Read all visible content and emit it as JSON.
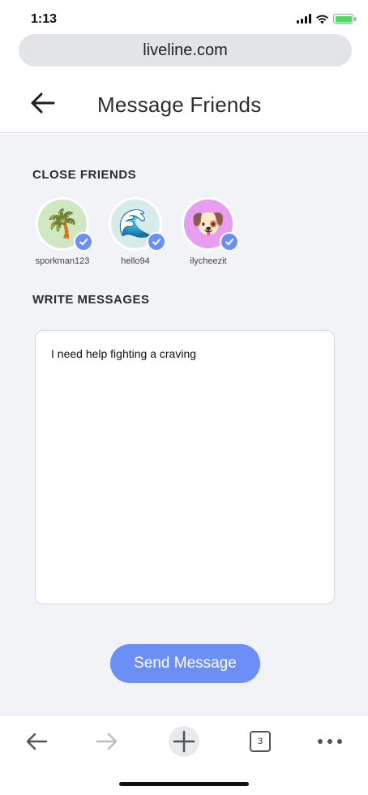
{
  "status_bar": {
    "time": "1:13"
  },
  "browser": {
    "url": "liveline.com",
    "tab_count": "3"
  },
  "header": {
    "title": "Message Friends"
  },
  "close_friends": {
    "heading": "CLOSE FRIENDS",
    "friends": [
      {
        "name": "sporkman123",
        "emoji": "🌴",
        "bg": "#cfe8c2",
        "selected": true
      },
      {
        "name": "hello94",
        "emoji": "🌊",
        "bg": "#d7ece9",
        "selected": true
      },
      {
        "name": "ilycheezit",
        "emoji": "🐶",
        "bg": "#e79ef0",
        "selected": true
      }
    ]
  },
  "write_messages": {
    "heading": "WRITE MESSAGES",
    "message_text": "I need help fighting a craving"
  },
  "send_button": {
    "label": "Send Message"
  },
  "colors": {
    "accent": "#6c8ef7",
    "background": "#f2f3f7"
  }
}
